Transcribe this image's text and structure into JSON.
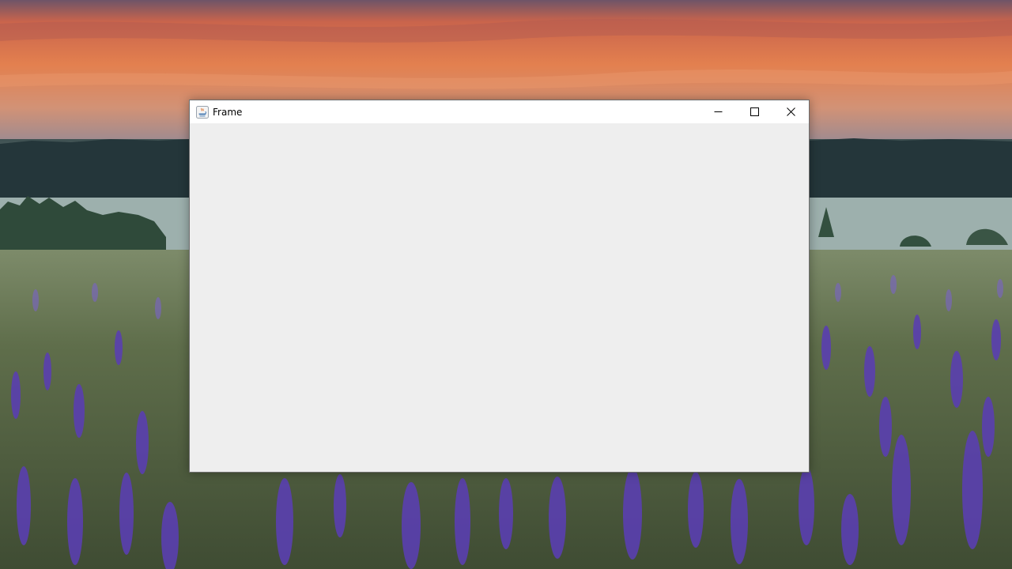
{
  "desktop": {
    "wallpaper": "lupine-field-at-sunset"
  },
  "window": {
    "title": "Frame",
    "icon": "java-icon",
    "controls": {
      "minimize": "minimize-icon",
      "maximize": "maximize-icon",
      "close": "close-icon"
    },
    "colors": {
      "titlebar": "#ffffff",
      "content": "#eeeeee",
      "close_hover": "#e81123"
    }
  }
}
